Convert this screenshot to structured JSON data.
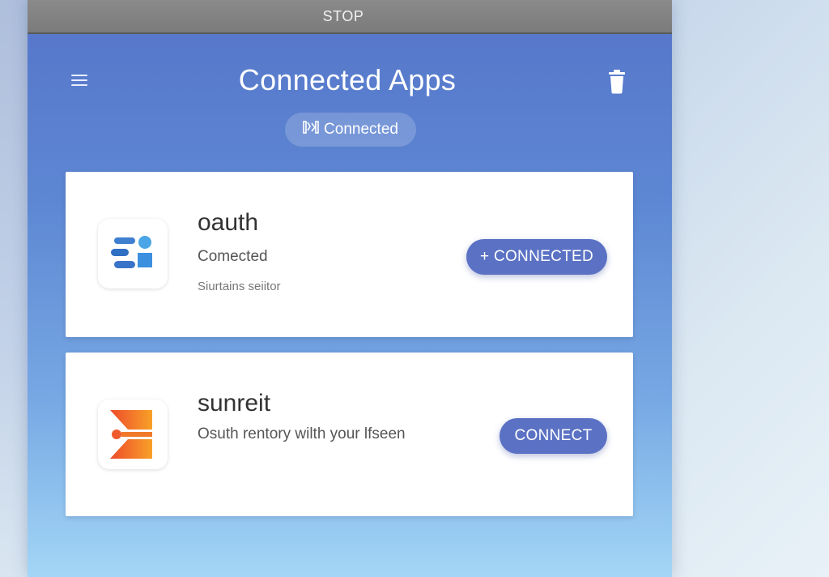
{
  "topbar": {
    "label": "STOP"
  },
  "header": {
    "title": "Connected Apps",
    "status_pill": {
      "icon": "link-status-icon",
      "label": "Connected"
    },
    "menu_icon": "hamburger-icon",
    "delete_icon": "trash-icon"
  },
  "apps": [
    {
      "name": "oauth",
      "subtitle": "Comected",
      "detail": "Siurtains seiitor",
      "icon": "blue-shapes-logo-icon",
      "button_label": "+ CONNECTED"
    },
    {
      "name": "sunreit",
      "subtitle": "Osuth rentory wilth your lfseen",
      "icon": "orange-chevron-logo-icon",
      "button_label": "CONNECT"
    }
  ],
  "colors": {
    "panel_top": "#5675c9",
    "panel_bottom": "#a3d6f6",
    "button": "#5b72c4",
    "topbar": "#8a8a8a",
    "icon_blue": "#3f7fd0",
    "icon_orange": "#ee5a2b"
  }
}
